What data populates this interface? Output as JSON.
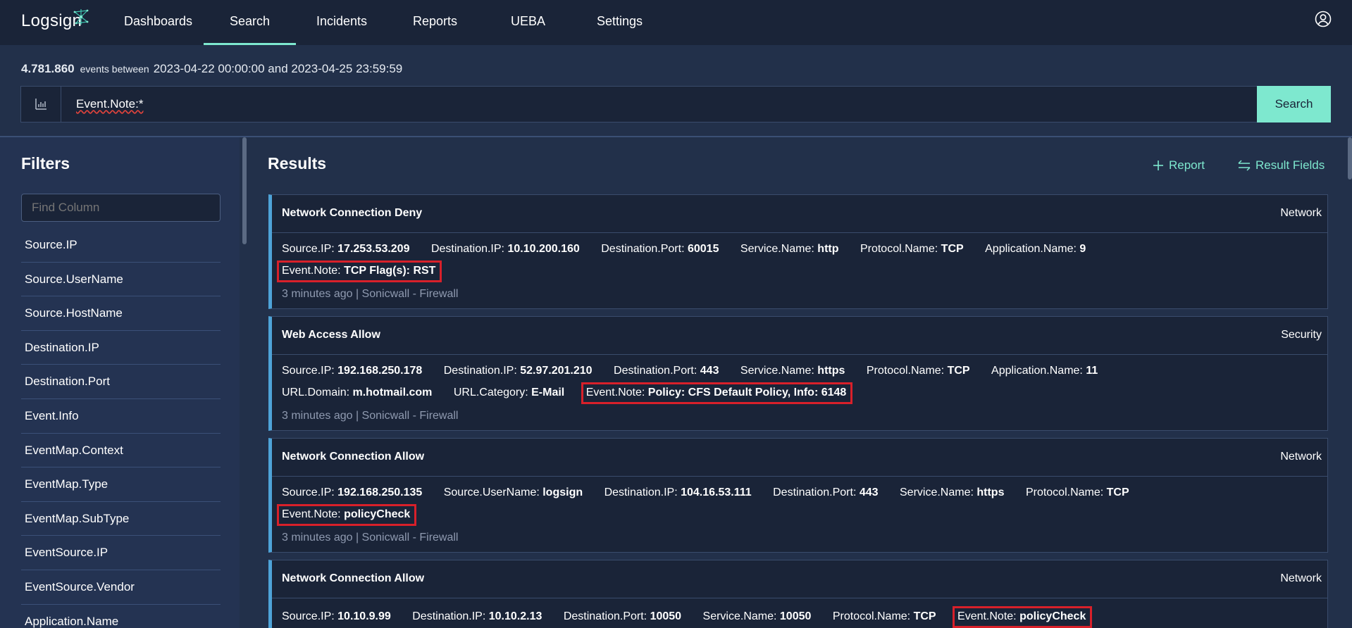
{
  "app": {
    "logo_text": "Logsign"
  },
  "nav": {
    "items": [
      {
        "label": "Dashboards"
      },
      {
        "label": "Search"
      },
      {
        "label": "Incidents"
      },
      {
        "label": "Reports"
      },
      {
        "label": "UEBA"
      },
      {
        "label": "Settings"
      }
    ],
    "active": "Search"
  },
  "summary": {
    "count": "4.781.860",
    "between_label": "events between",
    "range": "2023-04-22 00:00:00 and 2023-04-25 23:59:59"
  },
  "search": {
    "query": "Event.Note:*",
    "button": "Search"
  },
  "filters": {
    "title": "Filters",
    "find_placeholder": "Find Column",
    "columns": [
      "Source.IP",
      "Source.UserName",
      "Source.HostName",
      "Destination.IP",
      "Destination.Port",
      "Event.Info",
      "EventMap.Context",
      "EventMap.Type",
      "EventMap.SubType",
      "EventSource.IP",
      "EventSource.Vendor",
      "Application.Name"
    ]
  },
  "results": {
    "title": "Results",
    "report_label": "Report",
    "fields_label": "Result Fields",
    "cards": [
      {
        "title": "Network Connection Deny",
        "category": "Network",
        "lines": [
          [
            {
              "k": "Source.IP:",
              "v": "17.253.53.209"
            },
            {
              "k": "Destination.IP:",
              "v": "10.10.200.160"
            },
            {
              "k": "Destination.Port:",
              "v": "60015"
            },
            {
              "k": "Service.Name:",
              "v": "http"
            },
            {
              "k": "Protocol.Name:",
              "v": "TCP"
            },
            {
              "k": "Application.Name:",
              "v": "9"
            }
          ],
          [
            {
              "k": "Event.Note:",
              "v": "TCP Flag(s): RST",
              "highlight": true
            }
          ]
        ],
        "meta": "3 minutes ago | Sonicwall - Firewall"
      },
      {
        "title": "Web Access Allow",
        "category": "Security",
        "lines": [
          [
            {
              "k": "Source.IP:",
              "v": "192.168.250.178"
            },
            {
              "k": "Destination.IP:",
              "v": "52.97.201.210"
            },
            {
              "k": "Destination.Port:",
              "v": "443"
            },
            {
              "k": "Service.Name:",
              "v": "https"
            },
            {
              "k": "Protocol.Name:",
              "v": "TCP"
            },
            {
              "k": "Application.Name:",
              "v": "11"
            }
          ],
          [
            {
              "k": "URL.Domain:",
              "v": "m.hotmail.com"
            },
            {
              "k": "URL.Category:",
              "v": "E-Mail"
            },
            {
              "k": "Event.Note:",
              "v": "Policy: CFS Default Policy, Info: 6148",
              "highlight": true
            }
          ]
        ],
        "meta": "3 minutes ago | Sonicwall - Firewall"
      },
      {
        "title": "Network Connection Allow",
        "category": "Network",
        "lines": [
          [
            {
              "k": "Source.IP:",
              "v": "192.168.250.135"
            },
            {
              "k": "Source.UserName:",
              "v": "logsign"
            },
            {
              "k": "Destination.IP:",
              "v": "104.16.53.111"
            },
            {
              "k": "Destination.Port:",
              "v": "443"
            },
            {
              "k": "Service.Name:",
              "v": "https"
            },
            {
              "k": "Protocol.Name:",
              "v": "TCP"
            }
          ],
          [
            {
              "k": "Event.Note:",
              "v": "policyCheck",
              "highlight": true
            }
          ]
        ],
        "meta": "3 minutes ago | Sonicwall - Firewall"
      },
      {
        "title": "Network Connection Allow",
        "category": "Network",
        "lines": [
          [
            {
              "k": "Source.IP:",
              "v": "10.10.9.99"
            },
            {
              "k": "Destination.IP:",
              "v": "10.10.2.13"
            },
            {
              "k": "Destination.Port:",
              "v": "10050"
            },
            {
              "k": "Service.Name:",
              "v": "10050"
            },
            {
              "k": "Protocol.Name:",
              "v": "TCP"
            },
            {
              "k": "Event.Note:",
              "v": "policyCheck",
              "highlight": true
            }
          ]
        ],
        "meta": ""
      }
    ]
  },
  "icons": {
    "logo_mark": "network-node-icon",
    "user": "user-circle-icon",
    "chart": "bar-chart-icon",
    "report": "plus-icon",
    "fields": "swap-arrows-icon"
  },
  "colors": {
    "accent": "#7ee8cf",
    "highlight": "#d8202a",
    "card_stripe": "#4ea3d8"
  }
}
